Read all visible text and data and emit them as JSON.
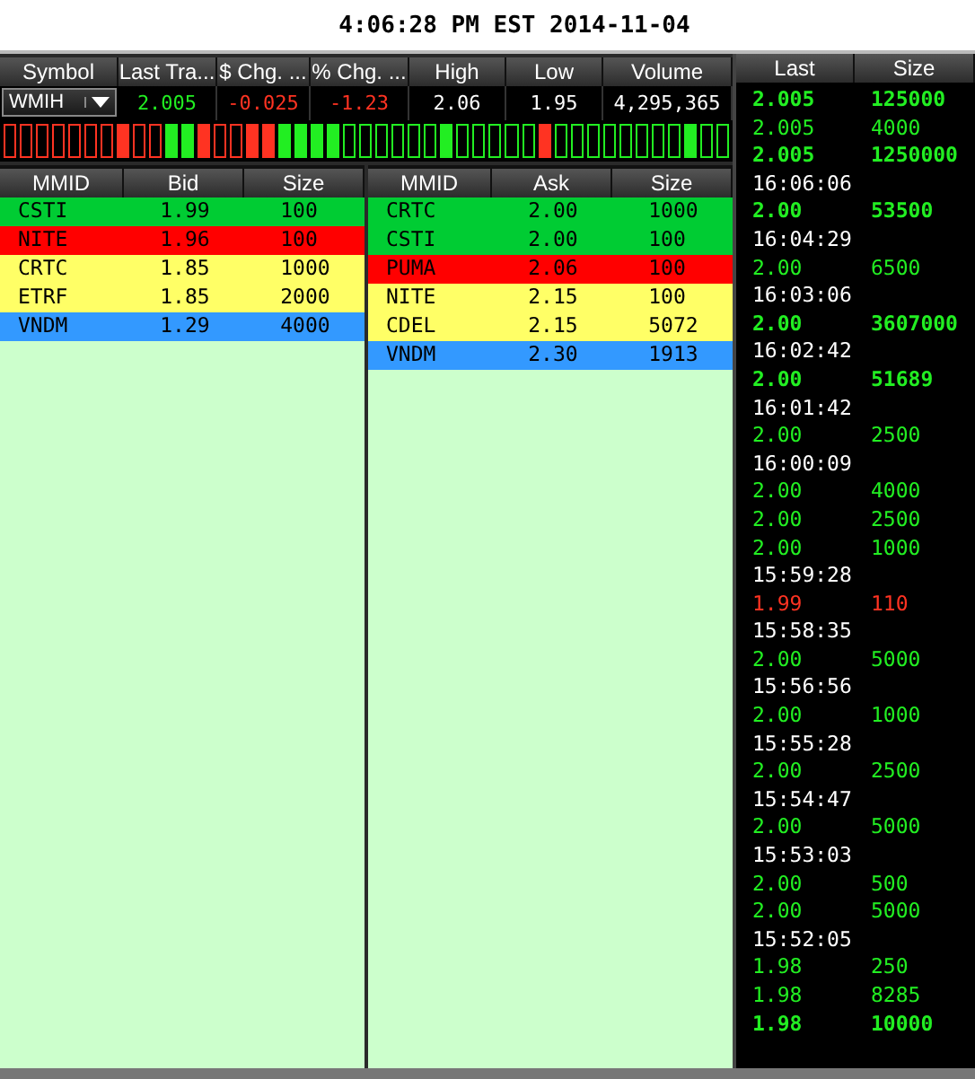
{
  "clock": "4:06:28 PM EST 2014-11-04",
  "quote": {
    "columns": [
      "Symbol",
      "Last Tra...",
      "$ Chg. ...",
      "% Chg. ...",
      "High",
      "Low",
      "Volume"
    ],
    "symbol": "WMIH",
    "values": [
      {
        "text": "2.005",
        "color": "#22ee22"
      },
      {
        "text": "-0.025",
        "color": "#ff3322"
      },
      {
        "text": "-1.23",
        "color": "#ff3322"
      },
      {
        "text": "2.06"
      },
      {
        "text": "1.95"
      },
      {
        "text": "4,295,365"
      }
    ]
  },
  "tick_strip": [
    {
      "color": "#ff3322",
      "filled": false
    },
    {
      "color": "#ff3322",
      "filled": false
    },
    {
      "color": "#ff3322",
      "filled": false
    },
    {
      "color": "#ff3322",
      "filled": false
    },
    {
      "color": "#ff3322",
      "filled": false
    },
    {
      "color": "#ff3322",
      "filled": false
    },
    {
      "color": "#ff3322",
      "filled": false
    },
    {
      "color": "#ff3322",
      "filled": true
    },
    {
      "color": "#ff3322",
      "filled": false
    },
    {
      "color": "#ff3322",
      "filled": false
    },
    {
      "color": "#22ee22",
      "filled": true
    },
    {
      "color": "#22ee22",
      "filled": true
    },
    {
      "color": "#ff3322",
      "filled": true
    },
    {
      "color": "#ff3322",
      "filled": false
    },
    {
      "color": "#ff3322",
      "filled": false
    },
    {
      "color": "#ff3322",
      "filled": true
    },
    {
      "color": "#ff3322",
      "filled": true
    },
    {
      "color": "#22ee22",
      "filled": true
    },
    {
      "color": "#22ee22",
      "filled": true
    },
    {
      "color": "#22ee22",
      "filled": true
    },
    {
      "color": "#22ee22",
      "filled": true
    },
    {
      "color": "#22ee22",
      "filled": false
    },
    {
      "color": "#22ee22",
      "filled": false
    },
    {
      "color": "#22ee22",
      "filled": false
    },
    {
      "color": "#22ee22",
      "filled": false
    },
    {
      "color": "#22ee22",
      "filled": false
    },
    {
      "color": "#22ee22",
      "filled": false
    },
    {
      "color": "#22ee22",
      "filled": true
    },
    {
      "color": "#22ee22",
      "filled": false
    },
    {
      "color": "#22ee22",
      "filled": false
    },
    {
      "color": "#22ee22",
      "filled": false
    },
    {
      "color": "#22ee22",
      "filled": false
    },
    {
      "color": "#22ee22",
      "filled": false
    },
    {
      "color": "#ff3322",
      "filled": true
    },
    {
      "color": "#22ee22",
      "filled": false
    },
    {
      "color": "#22ee22",
      "filled": false
    },
    {
      "color": "#22ee22",
      "filled": false
    },
    {
      "color": "#22ee22",
      "filled": false
    },
    {
      "color": "#22ee22",
      "filled": false
    },
    {
      "color": "#22ee22",
      "filled": false
    },
    {
      "color": "#22ee22",
      "filled": false
    },
    {
      "color": "#22ee22",
      "filled": false
    },
    {
      "color": "#22ee22",
      "filled": true
    },
    {
      "color": "#22ee22",
      "filled": false
    },
    {
      "color": "#22ee22",
      "filled": false
    }
  ],
  "bids": {
    "columns": [
      "MMID",
      "Bid",
      "Size"
    ],
    "rows": [
      {
        "cells": [
          "CSTI",
          "1.99",
          "100"
        ],
        "color": "#00cc33"
      },
      {
        "cells": [
          "NITE",
          "1.96",
          "100"
        ],
        "color": "#ff0000"
      },
      {
        "cells": [
          "CRTC",
          "1.85",
          "1000"
        ],
        "color": "#ffff66"
      },
      {
        "cells": [
          "ETRF",
          "1.85",
          "2000"
        ],
        "color": "#ffff66"
      },
      {
        "cells": [
          "VNDM",
          "1.29",
          "4000"
        ],
        "color": "#3399ff"
      }
    ]
  },
  "asks": {
    "columns": [
      "MMID",
      "Ask",
      "Size"
    ],
    "rows": [
      {
        "cells": [
          "CRTC",
          "2.00",
          "1000"
        ],
        "color": "#00cc33"
      },
      {
        "cells": [
          "CSTI",
          "2.00",
          "100"
        ],
        "color": "#00cc33"
      },
      {
        "cells": [
          "PUMA",
          "2.06",
          "100"
        ],
        "color": "#ff0000"
      },
      {
        "cells": [
          "NITE",
          "2.15",
          "100"
        ],
        "color": "#ffff66"
      },
      {
        "cells": [
          "CDEL",
          "2.15",
          "5072"
        ],
        "color": "#ffff66"
      },
      {
        "cells": [
          "VNDM",
          "2.30",
          "1913"
        ],
        "color": "#3399ff"
      }
    ]
  },
  "tape": {
    "columns": [
      "Last",
      "Size"
    ],
    "rows": [
      {
        "kind": "trade",
        "price": "2.005",
        "size": "125000",
        "color": "#22ee22",
        "bold": true
      },
      {
        "kind": "trade",
        "price": "2.005",
        "size": "4000",
        "color": "#22ee22",
        "bold": false
      },
      {
        "kind": "trade",
        "price": "2.005",
        "size": "1250000",
        "color": "#22ee22",
        "bold": true
      },
      {
        "kind": "time",
        "time": "16:06:06"
      },
      {
        "kind": "trade",
        "price": "2.00",
        "size": "53500",
        "color": "#22ee22",
        "bold": true
      },
      {
        "kind": "time",
        "time": "16:04:29"
      },
      {
        "kind": "trade",
        "price": "2.00",
        "size": "6500",
        "color": "#22ee22",
        "bold": false
      },
      {
        "kind": "time",
        "time": "16:03:06"
      },
      {
        "kind": "trade",
        "price": "2.00",
        "size": "3607000",
        "color": "#22ee22",
        "bold": true
      },
      {
        "kind": "time",
        "time": "16:02:42"
      },
      {
        "kind": "trade",
        "price": "2.00",
        "size": "51689",
        "color": "#22ee22",
        "bold": true
      },
      {
        "kind": "time",
        "time": "16:01:42"
      },
      {
        "kind": "trade",
        "price": "2.00",
        "size": "2500",
        "color": "#22ee22",
        "bold": false
      },
      {
        "kind": "time",
        "time": "16:00:09"
      },
      {
        "kind": "trade",
        "price": "2.00",
        "size": "4000",
        "color": "#22ee22",
        "bold": false
      },
      {
        "kind": "trade",
        "price": "2.00",
        "size": "2500",
        "color": "#22ee22",
        "bold": false
      },
      {
        "kind": "trade",
        "price": "2.00",
        "size": "1000",
        "color": "#22ee22",
        "bold": false
      },
      {
        "kind": "time",
        "time": "15:59:28"
      },
      {
        "kind": "trade",
        "price": "1.99",
        "size": "110",
        "color": "#ff3322",
        "bold": false
      },
      {
        "kind": "time",
        "time": "15:58:35"
      },
      {
        "kind": "trade",
        "price": "2.00",
        "size": "5000",
        "color": "#22ee22",
        "bold": false
      },
      {
        "kind": "time",
        "time": "15:56:56"
      },
      {
        "kind": "trade",
        "price": "2.00",
        "size": "1000",
        "color": "#22ee22",
        "bold": false
      },
      {
        "kind": "time",
        "time": "15:55:28"
      },
      {
        "kind": "trade",
        "price": "2.00",
        "size": "2500",
        "color": "#22ee22",
        "bold": false
      },
      {
        "kind": "time",
        "time": "15:54:47"
      },
      {
        "kind": "trade",
        "price": "2.00",
        "size": "5000",
        "color": "#22ee22",
        "bold": false
      },
      {
        "kind": "time",
        "time": "15:53:03"
      },
      {
        "kind": "trade",
        "price": "2.00",
        "size": "500",
        "color": "#22ee22",
        "bold": false
      },
      {
        "kind": "trade",
        "price": "2.00",
        "size": "5000",
        "color": "#22ee22",
        "bold": false
      },
      {
        "kind": "time",
        "time": "15:52:05"
      },
      {
        "kind": "trade",
        "price": "1.98",
        "size": "250",
        "color": "#22ee22",
        "bold": false
      },
      {
        "kind": "trade",
        "price": "1.98",
        "size": "8285",
        "color": "#22ee22",
        "bold": false
      },
      {
        "kind": "trade",
        "price": "1.98",
        "size": "10000",
        "color": "#22ee22",
        "bold": true
      }
    ]
  }
}
